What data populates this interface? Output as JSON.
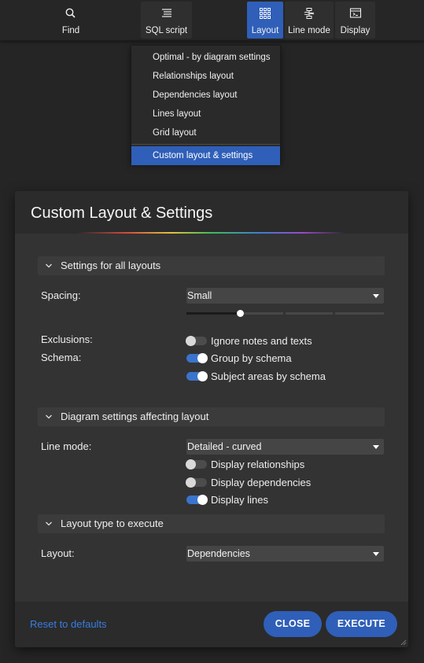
{
  "toolbar": {
    "buttons": [
      {
        "label": "Find",
        "icon": "search-icon"
      },
      {
        "label": "SQL script",
        "icon": "document-lines-icon"
      },
      {
        "label": "Layout",
        "icon": "grid-icon",
        "active": true
      },
      {
        "label": "Line mode",
        "icon": "line-mode-icon"
      },
      {
        "label": "Display",
        "icon": "display-window-icon"
      }
    ]
  },
  "layout_menu": {
    "items": [
      "Optimal - by diagram settings",
      "Relationships layout",
      "Dependencies layout",
      "Lines layout",
      "Grid layout"
    ],
    "selected_item": "Custom layout & settings"
  },
  "dialog": {
    "title": "Custom Layout & Settings",
    "sections": {
      "all_layouts": "Settings for all layouts",
      "diagram_settings": "Diagram settings affecting layout",
      "layout_type": "Layout type to execute"
    },
    "spacing": {
      "label": "Spacing:",
      "value": "Small",
      "slider_level": 0.27
    },
    "exclusions_label": "Exclusions:",
    "schema_label": "Schema:",
    "toggles": {
      "ignore_notes": {
        "label": "Ignore notes and texts",
        "on": false
      },
      "group_by_schema": {
        "label": "Group by schema",
        "on": true
      },
      "subject_areas": {
        "label": "Subject areas by schema",
        "on": true
      },
      "display_relationships": {
        "label": "Display relationships",
        "on": false
      },
      "display_dependencies": {
        "label": "Display dependencies",
        "on": false
      },
      "display_lines": {
        "label": "Display lines",
        "on": true
      }
    },
    "line_mode": {
      "label": "Line mode:",
      "value": "Detailed - curved"
    },
    "layout": {
      "label": "Layout:",
      "value": "Dependencies"
    },
    "footer": {
      "reset_label": "Reset to defaults",
      "close_label": "CLOSE",
      "execute_label": "EXECUTE"
    }
  },
  "colors": {
    "accent": "#2f5fb8",
    "toggle_on": "#3a74cc",
    "link": "#3a7de0",
    "background": "#252525"
  }
}
